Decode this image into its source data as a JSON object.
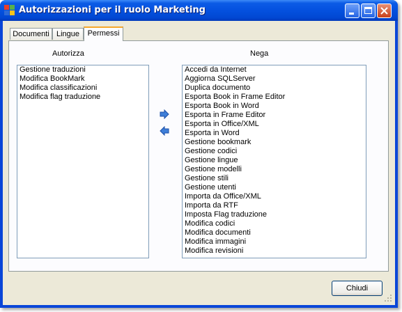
{
  "window": {
    "title": "Autorizzazioni per il ruolo Marketing",
    "title_buttons": [
      "minimize",
      "maximize",
      "close"
    ]
  },
  "tabs": [
    {
      "label": "Documenti",
      "active": false
    },
    {
      "label": "Lingue",
      "active": false
    },
    {
      "label": "Permessi",
      "active": true
    }
  ],
  "allow": {
    "label": "Autorizza",
    "items": [
      "Gestione traduzioni",
      "Modifica BookMark",
      "Modifica classificazioni",
      "Modifica flag traduzione"
    ]
  },
  "deny": {
    "label": "Nega",
    "items": [
      "Accedi da Internet",
      "Aggiorna SQLServer",
      "Duplica documento",
      "Esporta Book in Frame Editor",
      "Esporta Book in Word",
      "Esporta in Frame Editor",
      "Esporta in Office/XML",
      "Esporta in Word",
      "Gestione bookmark",
      "Gestione codici",
      "Gestione lingue",
      "Gestione modelli",
      "Gestione stili",
      "Gestione utenti",
      "Importa da Office/XML",
      "Importa da RTF",
      "Imposta Flag traduzione",
      "Modifica codici",
      "Modifica documenti",
      "Modifica immagini",
      "Modifica revisioni"
    ]
  },
  "arrows": {
    "move_right_icon": "arrow-right-icon",
    "move_left_icon": "arrow-left-icon"
  },
  "footer": {
    "close_label": "Chiudi"
  },
  "colors": {
    "titlebar": "#0451df",
    "dialog_bg": "#ece9d8",
    "list_border": "#7f9db9",
    "arrow": "#3f7fd8"
  }
}
